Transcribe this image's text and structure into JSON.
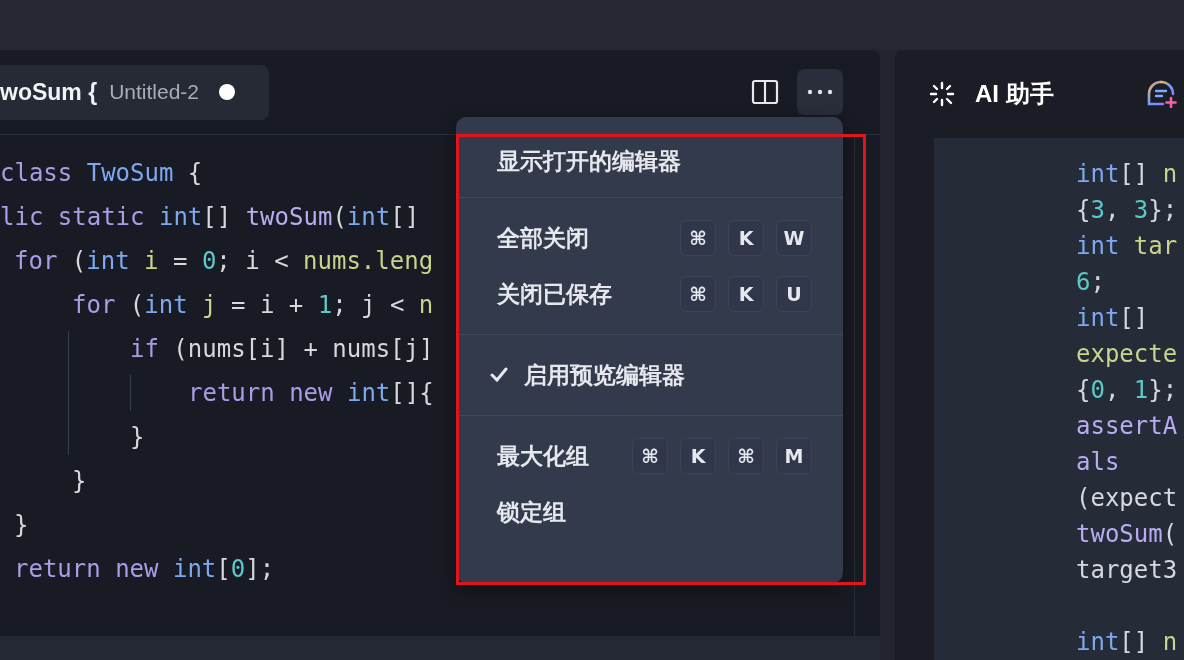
{
  "editor": {
    "tab": {
      "title": "woSum {",
      "file": "Untitled-2",
      "unsaved": true
    },
    "code": [
      {
        "tokens": [
          {
            "kind": "keyword",
            "text": "class "
          },
          {
            "kind": "type",
            "text": "TwoSum"
          },
          {
            "kind": "plain",
            "text": " {"
          }
        ]
      },
      {
        "tokens": [
          {
            "kind": "keyword",
            "text": "lic static "
          },
          {
            "kind": "type",
            "text": "int"
          },
          {
            "kind": "plain",
            "text": "[] "
          },
          {
            "kind": "func",
            "text": "twoSum"
          },
          {
            "kind": "plain",
            "text": "("
          },
          {
            "kind": "type",
            "text": "int"
          },
          {
            "kind": "plain",
            "text": "[]"
          }
        ],
        "children": [
          {
            "tokens": [
              {
                "kind": "keyword",
                "text": "for"
              },
              {
                "kind": "plain",
                "text": " ("
              },
              {
                "kind": "type",
                "text": "int"
              },
              {
                "kind": "var",
                "text": " i"
              },
              {
                "kind": "plain",
                "text": " = "
              },
              {
                "kind": "number",
                "text": "0"
              },
              {
                "kind": "plain",
                "text": "; i < "
              },
              {
                "kind": "var",
                "text": "nums.leng"
              }
            ],
            "children": [
              {
                "tokens": [
                  {
                    "kind": "keyword",
                    "text": "for"
                  },
                  {
                    "kind": "plain",
                    "text": " ("
                  },
                  {
                    "kind": "type",
                    "text": "int"
                  },
                  {
                    "kind": "var",
                    "text": " j"
                  },
                  {
                    "kind": "plain",
                    "text": " = i + "
                  },
                  {
                    "kind": "number",
                    "text": "1"
                  },
                  {
                    "kind": "plain",
                    "text": "; j < "
                  },
                  {
                    "kind": "var",
                    "text": "n"
                  }
                ],
                "children": [
                  {
                    "tokens": [
                      {
                        "kind": "keyword",
                        "text": "if"
                      },
                      {
                        "kind": "plain",
                        "text": " (nums[i] + nums[j]"
                      }
                    ],
                    "children": [
                      {
                        "tokens": [
                          {
                            "kind": "keyword",
                            "text": "return new "
                          },
                          {
                            "kind": "type",
                            "text": "int"
                          },
                          {
                            "kind": "plain",
                            "text": "[]{"
                          }
                        ]
                      }
                    ]
                  },
                  {
                    "tokens": [
                      {
                        "kind": "plain",
                        "text": "}"
                      }
                    ]
                  }
                ]
              },
              {
                "tokens": [
                  {
                    "kind": "plain",
                    "text": "}"
                  }
                ]
              }
            ]
          },
          {
            "tokens": [
              {
                "kind": "plain",
                "text": "}"
              }
            ]
          },
          {
            "tokens": [
              {
                "kind": "keyword",
                "text": "return new "
              },
              {
                "kind": "type",
                "text": "int"
              },
              {
                "kind": "plain",
                "text": "["
              },
              {
                "kind": "number",
                "text": "0"
              },
              {
                "kind": "plain",
                "text": "];"
              }
            ]
          }
        ]
      }
    ]
  },
  "menu": {
    "groups": [
      [
        {
          "label": "显示打开的编辑器",
          "checked": false
        }
      ],
      [
        {
          "label": "全部关闭",
          "checked": false,
          "shortcut": [
            "⌘",
            "K",
            "W"
          ]
        },
        {
          "label": "关闭已保存",
          "checked": false,
          "shortcut": [
            "⌘",
            "K",
            "U"
          ]
        }
      ],
      [
        {
          "label": "启用预览编辑器",
          "checked": true
        }
      ],
      [
        {
          "label": "最大化组",
          "checked": false,
          "shortcut": [
            "⌘",
            "K",
            "⌘",
            "M"
          ]
        },
        {
          "label": "锁定组",
          "checked": false
        }
      ]
    ]
  },
  "assistant": {
    "title": "AI 助手",
    "code_blocks": [
      [
        {
          "tokens": [
            {
              "kind": "type",
              "text": "int"
            },
            {
              "kind": "plain",
              "text": "[] "
            },
            {
              "kind": "var",
              "text": "n"
            }
          ]
        },
        {
          "tokens": [
            {
              "kind": "plain",
              "text": "{"
            },
            {
              "kind": "number",
              "text": "3"
            },
            {
              "kind": "plain",
              "text": ", "
            },
            {
              "kind": "number",
              "text": "3"
            },
            {
              "kind": "plain",
              "text": "};"
            }
          ]
        },
        {
          "tokens": [
            {
              "kind": "type",
              "text": "int"
            },
            {
              "kind": "var",
              "text": " tar"
            }
          ]
        },
        {
          "tokens": [
            {
              "kind": "number",
              "text": "6"
            },
            {
              "kind": "plain",
              "text": ";"
            }
          ]
        },
        {
          "tokens": [
            {
              "kind": "type",
              "text": "int"
            },
            {
              "kind": "plain",
              "text": "[]"
            }
          ]
        },
        {
          "tokens": [
            {
              "kind": "var",
              "text": "expecte"
            }
          ]
        },
        {
          "tokens": [
            {
              "kind": "plain",
              "text": "{"
            },
            {
              "kind": "number",
              "text": "0"
            },
            {
              "kind": "plain",
              "text": ", "
            },
            {
              "kind": "number",
              "text": "1"
            },
            {
              "kind": "plain",
              "text": "};"
            }
          ]
        },
        {
          "tokens": [
            {
              "kind": "func",
              "text": "assertA"
            }
          ]
        },
        {
          "tokens": [
            {
              "kind": "func",
              "text": "als"
            }
          ]
        },
        {
          "tokens": [
            {
              "kind": "plain",
              "text": "(expect"
            }
          ]
        },
        {
          "tokens": [
            {
              "kind": "func",
              "text": "twoSum"
            },
            {
              "kind": "plain",
              "text": "("
            }
          ]
        },
        {
          "tokens": [
            {
              "kind": "plain",
              "text": "target3"
            }
          ]
        }
      ],
      [
        {
          "tokens": [
            {
              "kind": "type",
              "text": "int"
            },
            {
              "kind": "plain",
              "text": "[] "
            },
            {
              "kind": "var",
              "text": "n"
            }
          ]
        }
      ]
    ]
  }
}
